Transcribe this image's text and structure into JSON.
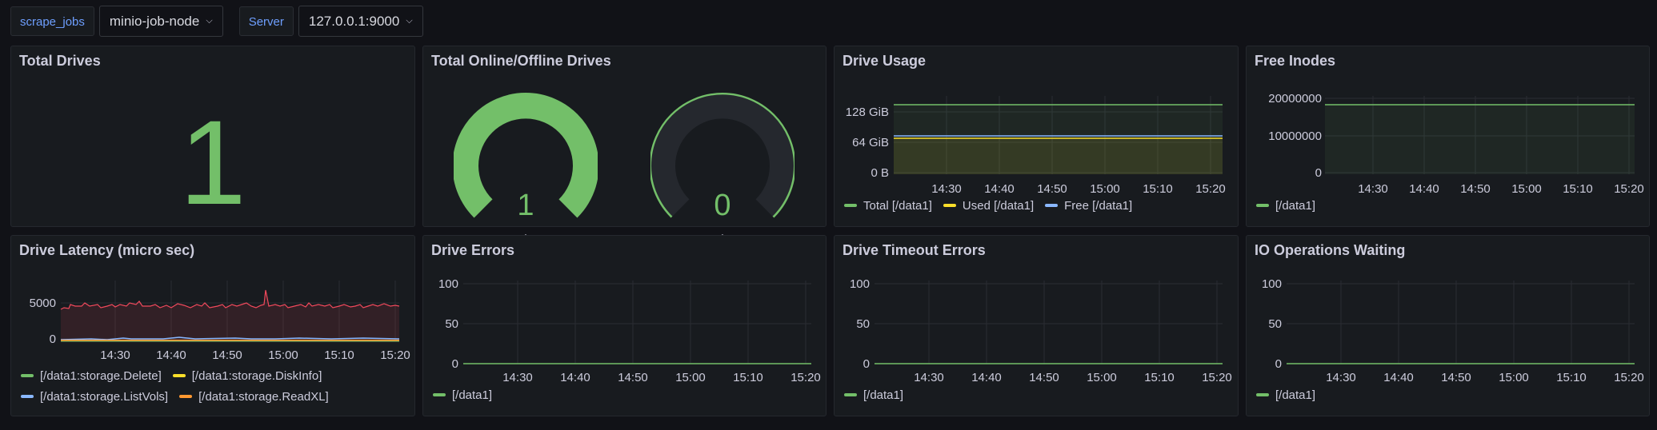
{
  "variables": [
    {
      "label": "scrape_jobs",
      "value": "minio-job-node"
    },
    {
      "label": "Server",
      "value": "127.0.0.1:9000"
    }
  ],
  "colors": {
    "green": "#73bf69",
    "yellow": "#fade2a",
    "blue": "#8ab8ff",
    "orange": "#ff9830",
    "red": "#f2495c"
  },
  "panels": {
    "total_drives": {
      "title": "Total Drives",
      "value": "1"
    },
    "online_offline": {
      "title": "Total Online/Offline Drives",
      "online": "1",
      "offline": "0",
      "online_unit": ".",
      "offline_unit": "."
    },
    "drive_usage": {
      "title": "Drive Usage",
      "y_ticks": [
        "128 GiB",
        "64 GiB",
        "0 B"
      ],
      "x_ticks": [
        "14:30",
        "14:40",
        "14:50",
        "15:00",
        "15:10",
        "15:20"
      ],
      "legend": [
        "Total [/data1]",
        "Used [/data1]",
        "Free [/data1]"
      ]
    },
    "free_inodes": {
      "title": "Free Inodes",
      "y_ticks": [
        "20000000",
        "10000000",
        "0"
      ],
      "x_ticks": [
        "14:30",
        "14:40",
        "14:50",
        "15:00",
        "15:10",
        "15:20"
      ],
      "legend": [
        "[/data1]"
      ]
    },
    "drive_latency": {
      "title": "Drive Latency (micro sec)",
      "y_ticks": [
        "5000",
        "0"
      ],
      "x_ticks": [
        "14:30",
        "14:40",
        "14:50",
        "15:00",
        "15:10",
        "15:20"
      ],
      "legend": [
        "[/data1:storage.Delete]",
        "[/data1:storage.DiskInfo]",
        "[/data1:storage.ListVols]",
        "[/data1:storage.ReadXL]"
      ]
    },
    "drive_errors": {
      "title": "Drive Errors",
      "y_ticks": [
        "100",
        "50",
        "0"
      ],
      "x_ticks": [
        "14:30",
        "14:40",
        "14:50",
        "15:00",
        "15:10",
        "15:20"
      ],
      "legend": [
        "[/data1]"
      ]
    },
    "drive_timeout": {
      "title": "Drive Timeout Errors",
      "y_ticks": [
        "100",
        "50",
        "0"
      ],
      "x_ticks": [
        "14:30",
        "14:40",
        "14:50",
        "15:00",
        "15:10",
        "15:20"
      ],
      "legend": [
        "[/data1]"
      ]
    },
    "io_waiting": {
      "title": "IO Operations Waiting",
      "y_ticks": [
        "100",
        "50",
        "0"
      ],
      "x_ticks": [
        "14:30",
        "14:40",
        "14:50",
        "15:00",
        "15:10",
        "15:20"
      ],
      "legend": [
        "[/data1]"
      ]
    }
  },
  "chart_data": [
    {
      "type": "line",
      "title": "Drive Usage",
      "x": [
        "14:30",
        "14:40",
        "14:50",
        "15:00",
        "15:10",
        "15:20"
      ],
      "series": [
        {
          "name": "Total [/data1]",
          "values": [
            147,
            147,
            147,
            147,
            147,
            147
          ]
        },
        {
          "name": "Used [/data1]",
          "values": [
            69,
            69,
            69,
            69,
            69,
            69
          ]
        },
        {
          "name": "Free [/data1]",
          "values": [
            74,
            74,
            74,
            74,
            74,
            74
          ]
        }
      ],
      "ylabel": "",
      "ylim": [
        0,
        160
      ]
    },
    {
      "type": "line",
      "title": "Free Inodes",
      "x": [
        "14:30",
        "14:40",
        "14:50",
        "15:00",
        "15:10",
        "15:20"
      ],
      "series": [
        {
          "name": "[/data1]",
          "values": [
            18000000,
            18000000,
            18000000,
            18000000,
            18000000,
            18000000
          ]
        }
      ],
      "ylim": [
        0,
        22000000
      ]
    },
    {
      "type": "line",
      "title": "Drive Latency (micro sec)",
      "x": [
        "14:30",
        "14:40",
        "14:50",
        "15:00",
        "15:10",
        "15:20"
      ],
      "series": [
        {
          "name": "[/data1:storage.Delete]",
          "values": [
            0,
            0,
            0,
            0,
            0,
            0
          ]
        },
        {
          "name": "[/data1:storage.DiskInfo]",
          "values": [
            0,
            0,
            0,
            0,
            0,
            0
          ]
        },
        {
          "name": "[/data1:storage.ListVols]",
          "values": [
            100,
            100,
            100,
            100,
            100,
            100
          ]
        },
        {
          "name": "[/data1:storage.ReadXL]",
          "values": [
            0,
            0,
            0,
            0,
            0,
            0
          ]
        },
        {
          "name": "",
          "values": [
            4500,
            4200,
            4100,
            4500,
            4300,
            4200
          ]
        }
      ],
      "ylim": [
        0,
        7000
      ]
    },
    {
      "type": "line",
      "title": "Drive Errors",
      "x": [
        "14:30",
        "14:40",
        "14:50",
        "15:00",
        "15:10",
        "15:20"
      ],
      "series": [
        {
          "name": "[/data1]",
          "values": [
            0,
            0,
            0,
            0,
            0,
            0
          ]
        }
      ],
      "ylim": [
        0,
        100
      ]
    },
    {
      "type": "line",
      "title": "Drive Timeout Errors",
      "x": [
        "14:30",
        "14:40",
        "14:50",
        "15:00",
        "15:10",
        "15:20"
      ],
      "series": [
        {
          "name": "[/data1]",
          "values": [
            0,
            0,
            0,
            0,
            0,
            0
          ]
        }
      ],
      "ylim": [
        0,
        100
      ]
    },
    {
      "type": "line",
      "title": "IO Operations Waiting",
      "x": [
        "14:30",
        "14:40",
        "14:50",
        "15:00",
        "15:10",
        "15:20"
      ],
      "series": [
        {
          "name": "[/data1]",
          "values": [
            0,
            0,
            0,
            0,
            0,
            0
          ]
        }
      ],
      "ylim": [
        0,
        100
      ]
    }
  ]
}
